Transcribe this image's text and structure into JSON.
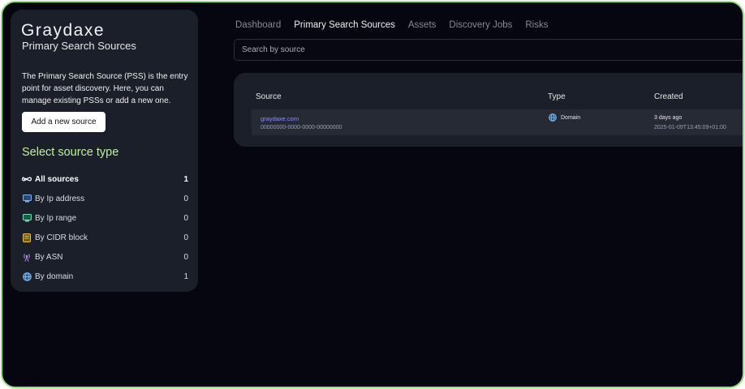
{
  "sidebar": {
    "brand": "Graydaxe",
    "subtitle": "Primary Search Sources",
    "description": "The Primary Search Source (PSS) is the entry point for asset discovery. Here, you can manage existing PSSs or add a new one.",
    "add_button": "Add a new source",
    "types_heading": "Select source type",
    "types": [
      {
        "label": "All sources",
        "count": "1",
        "icon": "infinity-icon"
      },
      {
        "label": "By Ip address",
        "count": "0",
        "icon": "monitor-icon"
      },
      {
        "label": "By Ip range",
        "count": "0",
        "icon": "monitor-range-icon"
      },
      {
        "label": "By CIDR block",
        "count": "0",
        "icon": "cidr-block-icon"
      },
      {
        "label": "By ASN",
        "count": "0",
        "icon": "broadcast-icon"
      },
      {
        "label": "By domain",
        "count": "1",
        "icon": "globe-icon"
      }
    ]
  },
  "nav": {
    "tabs": [
      {
        "label": "Dashboard"
      },
      {
        "label": "Primary Search Sources"
      },
      {
        "label": "Assets"
      },
      {
        "label": "Discovery Jobs"
      },
      {
        "label": "Risks"
      }
    ],
    "active_tab": "Primary Search Sources"
  },
  "search": {
    "placeholder": "Search by source"
  },
  "table": {
    "columns": [
      "Source",
      "Type",
      "Created"
    ],
    "rows": [
      {
        "source": "graydaxe.com",
        "source_id": "00000000-0000-0000-00000000",
        "type": "Domain",
        "type_icon": "globe-icon",
        "created": "3 days ago",
        "created_ts": "2025-01-09T13:45:09+01:00"
      }
    ]
  },
  "colors": {
    "frame_border": "#8fe07a",
    "background": "#05060f",
    "panel": "#1b1f29",
    "row": "#252a35",
    "accent_green": "#bff09e",
    "link": "#8e8ff8"
  }
}
